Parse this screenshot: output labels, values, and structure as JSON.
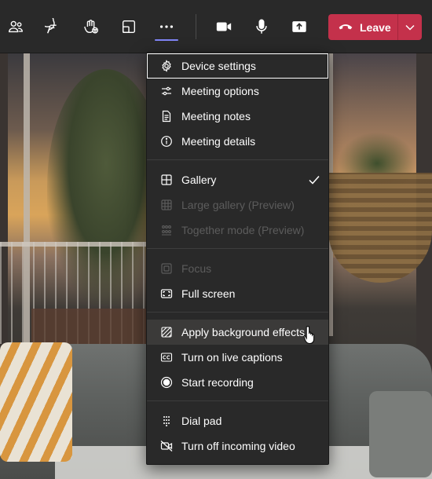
{
  "toolbar": {
    "buttons": [
      {
        "name": "people-icon"
      },
      {
        "name": "chat-icon"
      },
      {
        "name": "reactions-icon"
      },
      {
        "name": "rooms-icon"
      },
      {
        "name": "more-actions-icon"
      },
      {
        "name": "camera-icon"
      },
      {
        "name": "mic-icon"
      },
      {
        "name": "share-icon"
      }
    ],
    "leave_label": "Leave",
    "leave_color": "#c4314b",
    "active_underline_color": "#7f85f5"
  },
  "menu": {
    "items": [
      {
        "label": "Device settings",
        "icon": "gear-icon",
        "state": "focused"
      },
      {
        "label": "Meeting options",
        "icon": "sliders-icon"
      },
      {
        "label": "Meeting notes",
        "icon": "notes-icon"
      },
      {
        "label": "Meeting details",
        "icon": "info-icon"
      },
      {
        "label": "Gallery",
        "icon": "gallery-icon",
        "checked": true
      },
      {
        "label": "Large gallery (Preview)",
        "icon": "large-gallery-icon",
        "disabled": true
      },
      {
        "label": "Together mode (Preview)",
        "icon": "together-mode-icon",
        "disabled": true
      },
      {
        "label": "Focus",
        "icon": "focus-icon",
        "disabled": true
      },
      {
        "label": "Full screen",
        "icon": "fullscreen-icon"
      },
      {
        "label": "Apply background effects",
        "icon": "background-effects-icon",
        "state": "hovered"
      },
      {
        "label": "Turn on live captions",
        "icon": "cc-icon"
      },
      {
        "label": "Start recording",
        "icon": "record-icon"
      },
      {
        "label": "Dial pad",
        "icon": "dialpad-icon"
      },
      {
        "label": "Turn off incoming video",
        "icon": "video-off-icon"
      }
    ]
  }
}
